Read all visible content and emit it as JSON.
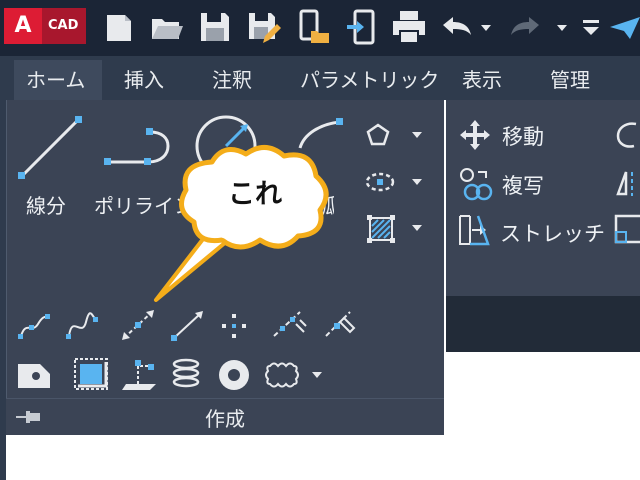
{
  "app": {
    "logo_letter": "A",
    "logo_text": "CAD"
  },
  "quick_access": [
    "new-icon",
    "open-icon",
    "save-icon",
    "save-as-icon",
    "open-from-mobile-icon",
    "save-to-mobile-icon",
    "plot-icon",
    "undo-icon",
    "redo-icon",
    "customize-icon",
    "share-icon"
  ],
  "tabs": [
    {
      "label": "ホーム",
      "active": true
    },
    {
      "label": "挿入"
    },
    {
      "label": "注釈"
    },
    {
      "label": "パラメトリック"
    },
    {
      "label": "表示"
    },
    {
      "label": "管理"
    }
  ],
  "create_panel": {
    "title": "作成",
    "line_label": "線分",
    "polyline_label": "ポリライン",
    "arc_label_partial": "弧"
  },
  "modify_panel": {
    "move_label": "移動",
    "copy_label": "複写",
    "stretch_label": "ストレッチ"
  },
  "callout": {
    "text": "これ"
  },
  "colors": {
    "ribbon_bg": "#3b4455",
    "qat_bg": "#1b2536",
    "tab_bg": "#2f3b4d",
    "icon_blue": "#59b4f0",
    "callout_fill": "#ffffff",
    "callout_border": "#f4ad1a"
  }
}
